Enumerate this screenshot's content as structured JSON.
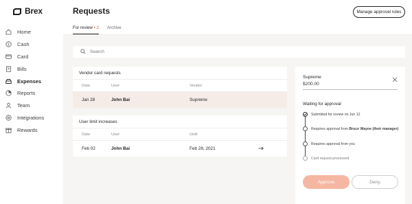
{
  "brand": {
    "name": "Brex"
  },
  "sidebar": {
    "items": [
      {
        "label": "Home",
        "icon": "home-icon"
      },
      {
        "label": "Cash",
        "icon": "dollar-icon"
      },
      {
        "label": "Card",
        "icon": "card-icon"
      },
      {
        "label": "Bills",
        "icon": "bills-icon"
      },
      {
        "label": "Expenses",
        "icon": "expenses-icon",
        "active": true
      },
      {
        "label": "Reports",
        "icon": "reports-icon"
      },
      {
        "label": "Team",
        "icon": "team-icon"
      },
      {
        "label": "Integrations",
        "icon": "integrations-icon"
      },
      {
        "label": "Rewards",
        "icon": "rewards-icon"
      }
    ]
  },
  "header": {
    "title": "Requests",
    "manage_label": "Manage approval rules"
  },
  "tabs": [
    {
      "label": "For review",
      "count": "2",
      "active": true
    },
    {
      "label": "Archive"
    }
  ],
  "search": {
    "placeholder": "Search"
  },
  "vendor_card": {
    "title": "Vendor card requests",
    "columns": [
      "Date",
      "User",
      "Vendor"
    ],
    "rows": [
      {
        "date": "Jan 28",
        "user": "John Bai",
        "vendor": "Supreme"
      }
    ]
  },
  "user_limit": {
    "title": "User limit increases",
    "columns": [
      "Date",
      "User",
      "Until"
    ],
    "rows": [
      {
        "date": "Feb 02",
        "user": "John Bai",
        "until": "Feb 28, 2021"
      }
    ]
  },
  "panel": {
    "name": "Supreme",
    "amount": "$200.00",
    "waiting_title": "Waiting for approval",
    "steps": [
      {
        "text": "Submitted for review on Jun 12",
        "state": "done"
      },
      {
        "prefix": "Requires approval from ",
        "who": "Bruce Wayne (their manager)",
        "state": "pending"
      },
      {
        "prefix": "Requires approval from ",
        "who": "you",
        "state": "pending"
      },
      {
        "text": "Card request processed",
        "state": "future"
      }
    ],
    "approve_label": "Approve",
    "deny_label": "Deny"
  },
  "colors": {
    "accent": "#e0643c",
    "approve": "#f5b7a2",
    "highlight_row": "#f5ece7",
    "background": "#f6f5f3"
  }
}
